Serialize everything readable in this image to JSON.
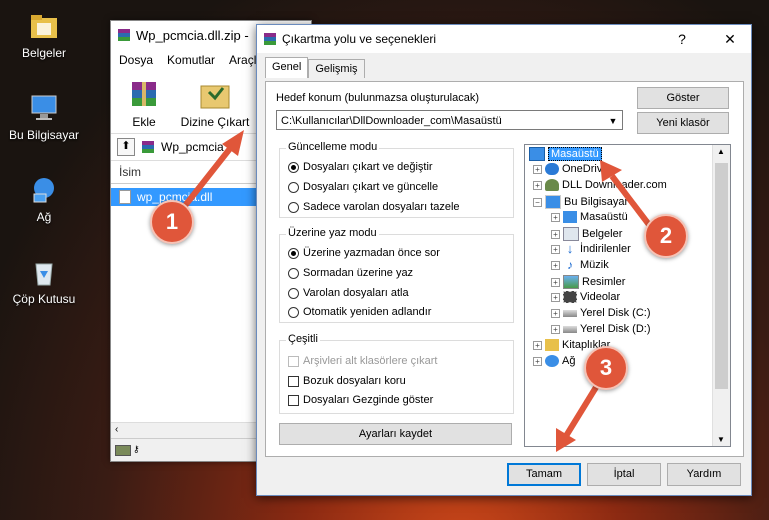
{
  "desktop": {
    "icons": [
      {
        "label": "Belgeler",
        "icon": "folder-icon"
      },
      {
        "label": "Bu Bilgisayar",
        "icon": "computer-icon"
      },
      {
        "label": "Ağ",
        "icon": "network-icon"
      },
      {
        "label": "Çöp Kutusu",
        "icon": "recycle-bin-icon"
      }
    ]
  },
  "winrar": {
    "title": "Wp_pcmcia.dll.zip -",
    "menu": [
      "Dosya",
      "Komutlar",
      "Araçla"
    ],
    "toolbar": {
      "add_label": "Ekle",
      "extract_label": "Dizine Çıkart"
    },
    "path": "Wp_pcmcia",
    "column_name": "İsim",
    "file": "wp_pcmcia.dll"
  },
  "dialog": {
    "title": "Çıkartma yolu ve seçenekleri",
    "help_label": "?",
    "close_label": "✕",
    "tabs": [
      "Genel",
      "Gelişmiş"
    ],
    "dest_label": "Hedef konum (bulunmazsa oluşturulacak)",
    "dest_value": "C:\\Kullanıcılar\\DllDownloader_com\\Masaüstü",
    "show_button": "Göster",
    "new_folder_button": "Yeni klasör",
    "update_group": {
      "title": "Güncelleme modu",
      "options": [
        "Dosyaları çıkart ve değiştir",
        "Dosyaları çıkart ve güncelle",
        "Sadece varolan dosyaları tazele"
      ],
      "selected": 0
    },
    "overwrite_group": {
      "title": "Üzerine yaz modu",
      "options": [
        "Üzerine yazmadan önce sor",
        "Sormadan üzerine yaz",
        "Varolan dosyaları atla",
        "Otomatik yeniden adlandır"
      ],
      "selected": 0
    },
    "misc_group": {
      "title": "Çeşitli",
      "options": [
        "Arşivleri alt klasörlere çıkart",
        "Bozuk dosyaları koru",
        "Dosyaları Gezginde göster"
      ]
    },
    "save_settings_button": "Ayarları kaydet",
    "tree": {
      "root": "Masaüstü",
      "items": [
        "OneDrive",
        "DLL Downloader.com",
        "Bu Bilgisayar",
        "Masaüstü",
        "Belgeler",
        "İndirilenler",
        "Müzik",
        "Resimler",
        "Videolar",
        "Yerel Disk (C:)",
        "Yerel Disk (D:)",
        "Kitaplıklar",
        "Ağ"
      ]
    },
    "ok_button": "Tamam",
    "cancel_button": "İptal",
    "help_button": "Yardım"
  },
  "callouts": [
    "1",
    "2",
    "3"
  ],
  "colors": {
    "accent": "#0078d7",
    "callout": "#e0563a",
    "selection": "#3399ff"
  }
}
